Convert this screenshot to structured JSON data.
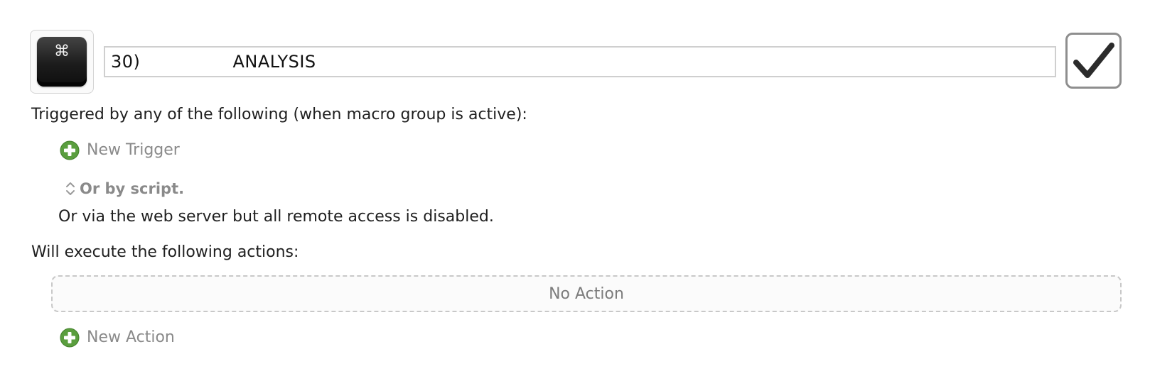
{
  "macro": {
    "icon": "command-key-icon",
    "icon_glyph": "⌘",
    "name": "30)                ANALYSIS",
    "enabled": true
  },
  "triggers": {
    "heading": "Triggered by any of the following (when macro group is active):",
    "new_trigger_label": "New Trigger",
    "or_by_script_label": "Or by script.",
    "web_server_note": "Or via the web server but all remote access is disabled."
  },
  "actions": {
    "heading": "Will execute the following actions:",
    "empty_label": "No Action",
    "new_action_label": "New Action"
  },
  "colors": {
    "add_icon_green": "#5a9e3e",
    "checkmark": "#2b2b2b"
  }
}
